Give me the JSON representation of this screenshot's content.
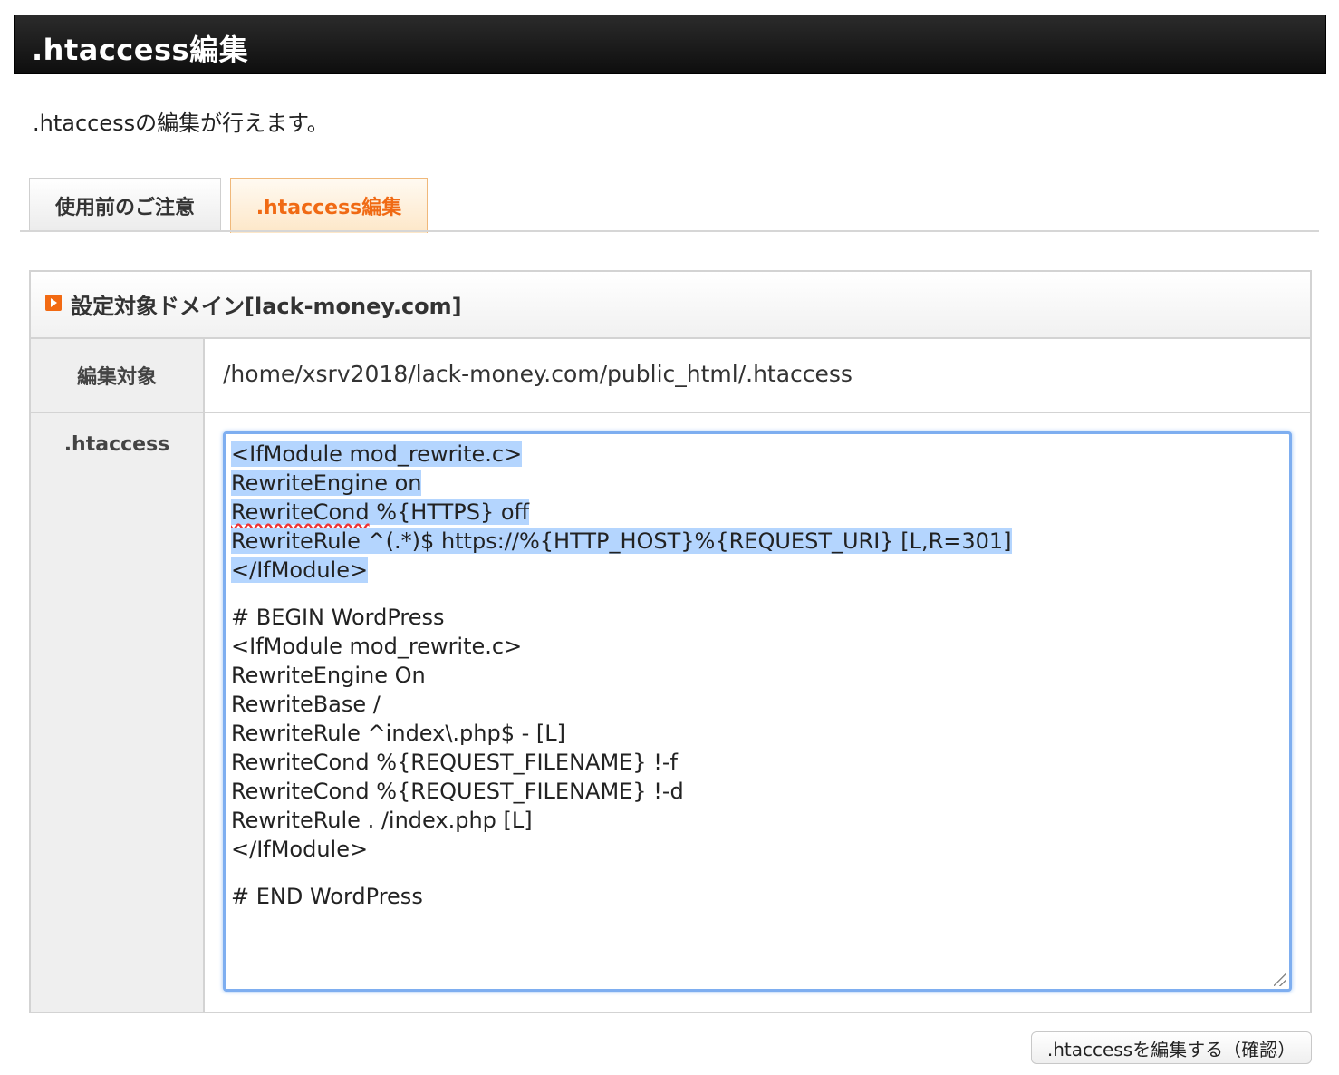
{
  "header": {
    "title": ".htaccess編集"
  },
  "description": ".htaccessの編集が行えます。",
  "tabs": [
    {
      "label": "使用前のご注意",
      "active": false
    },
    {
      "label": ".htaccess編集",
      "active": true
    }
  ],
  "panel": {
    "title": "設定対象ドメイン[lack-money.com]",
    "rows": {
      "target_label": "編集対象",
      "target_value": "/home/xsrv2018/lack-money.com/public_html/.htaccess",
      "htaccess_label": ".htaccess"
    }
  },
  "editor": {
    "selected_lines": [
      "<IfModule mod_rewrite.c>",
      "RewriteEngine on",
      "RewriteCond %{HTTPS} off",
      "RewriteRule ^(.*)$ https://%{HTTP_HOST}%{REQUEST_URI} [L,R=301]",
      "</IfModule>"
    ],
    "spellcheck_word": "RewriteCond",
    "spellcheck_rest": " %{HTTPS} off",
    "lines": [
      "# BEGIN WordPress",
      "<IfModule mod_rewrite.c>",
      "RewriteEngine On",
      "RewriteBase /",
      "RewriteRule ^index\\.php$ - [L]",
      "RewriteCond %{REQUEST_FILENAME} !-f",
      "RewriteCond %{REQUEST_FILENAME} !-d",
      "RewriteRule . /index.php [L]",
      "</IfModule>"
    ],
    "end_line": "# END WordPress"
  },
  "submit_label": ".htaccessを編集する（確認）",
  "colors": {
    "accent": "#f06a14",
    "selection": "#b4d5fe",
    "focus_border": "#7eaef0"
  }
}
